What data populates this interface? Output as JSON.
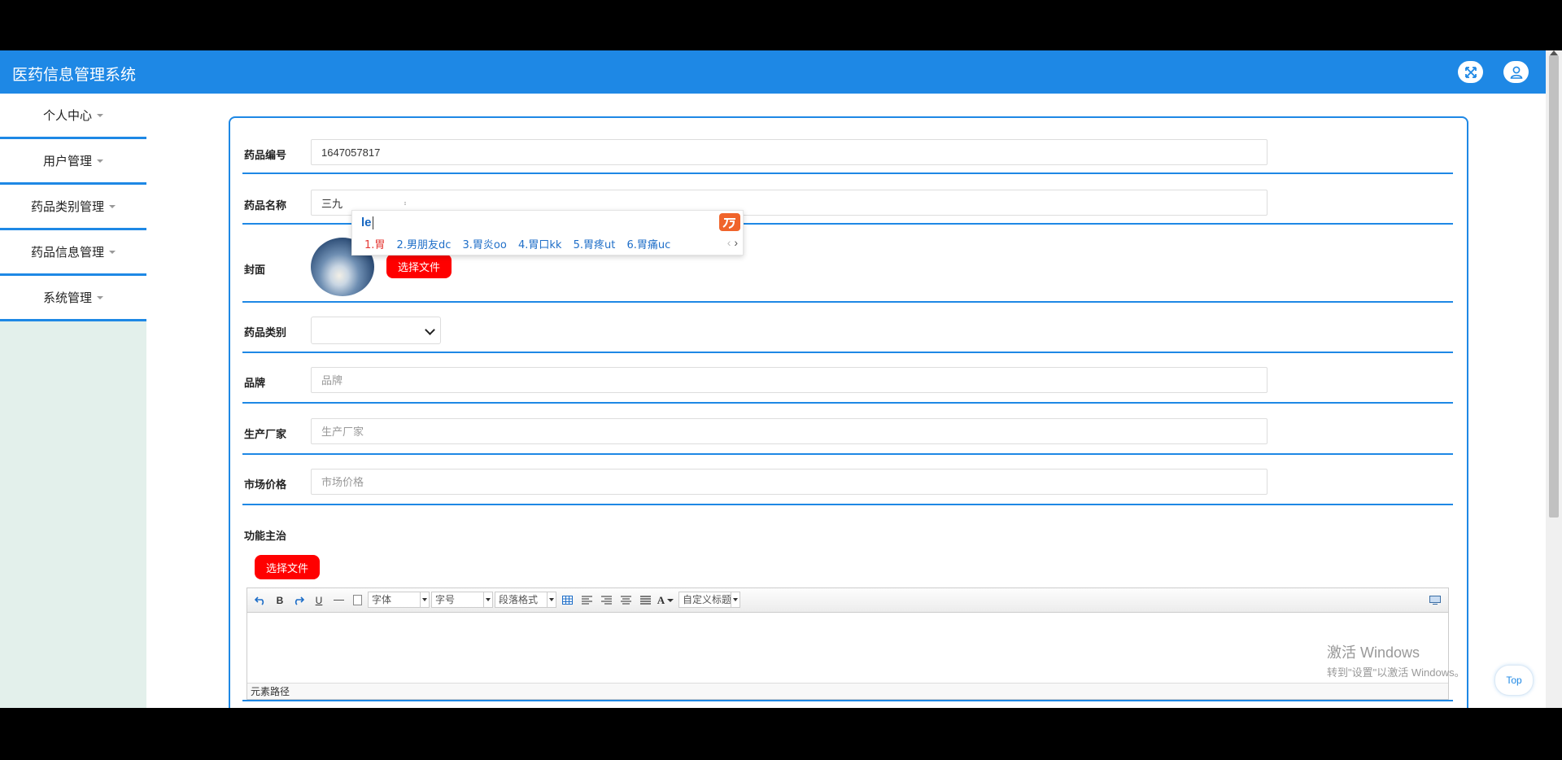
{
  "app": {
    "title": "医药信息管理系统"
  },
  "header": {
    "fullscreen_icon": "expand-icon",
    "user_icon": "user-icon"
  },
  "sidebar": {
    "items": [
      {
        "label": "个人中心"
      },
      {
        "label": "用户管理"
      },
      {
        "label": "药品类别管理"
      },
      {
        "label": "药品信息管理"
      },
      {
        "label": "系统管理"
      }
    ]
  },
  "form": {
    "code": {
      "label": "药品编号",
      "value": "1647057817"
    },
    "name": {
      "label": "药品名称",
      "value": "三九"
    },
    "cover": {
      "label": "封面",
      "button": "选择文件"
    },
    "category": {
      "label": "药品类别",
      "value": ""
    },
    "brand": {
      "label": "品牌",
      "placeholder": "品牌"
    },
    "manufacturer": {
      "label": "生产厂家",
      "placeholder": "生产厂家"
    },
    "price": {
      "label": "市场价格",
      "placeholder": "市场价格"
    },
    "function": {
      "label": "功能主治",
      "button": "选择文件"
    }
  },
  "editor": {
    "bold": "B",
    "underline": "U",
    "font_family": "字体",
    "font_size": "字号",
    "paragraph": "段落格式",
    "font_color": "A",
    "custom_title": "自定义标题",
    "element_path": "元素路径"
  },
  "ime": {
    "input": "le",
    "candidates": [
      "1.胃",
      "2.男朋友dc",
      "3.胃炎oo",
      "4.胃口kk",
      "5.胃疼ut",
      "6.胃痛uc"
    ]
  },
  "watermark": {
    "line1": "激活 Windows",
    "line2": "转到\"设置\"以激活 Windows。"
  },
  "top_button": "Top",
  "colors": {
    "primary": "#1e88e5",
    "danger": "#ff0000",
    "sidebar_bg": "#e3f0eb"
  }
}
